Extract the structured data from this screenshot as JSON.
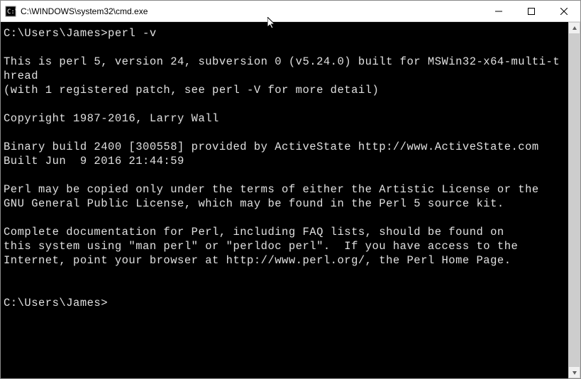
{
  "window": {
    "title": "C:\\WINDOWS\\system32\\cmd.exe"
  },
  "terminal": {
    "prompt1": "C:\\Users\\James>",
    "command1": "perl -v",
    "blank": "",
    "line1": "This is perl 5, version 24, subversion 0 (v5.24.0) built for MSWin32-x64-multi-thread",
    "line2": "(with 1 registered patch, see perl -V for more detail)",
    "line3": "Copyright 1987-2016, Larry Wall",
    "line4": "Binary build 2400 [300558] provided by ActiveState http://www.ActiveState.com",
    "line5": "Built Jun  9 2016 21:44:59",
    "line6": "Perl may be copied only under the terms of either the Artistic License or the",
    "line7": "GNU General Public License, which may be found in the Perl 5 source kit.",
    "line8": "Complete documentation for Perl, including FAQ lists, should be found on",
    "line9": "this system using \"man perl\" or \"perldoc perl\".  If you have access to the",
    "line10": "Internet, point your browser at http://www.perl.org/, the Perl Home Page.",
    "prompt2": "C:\\Users\\James>"
  }
}
